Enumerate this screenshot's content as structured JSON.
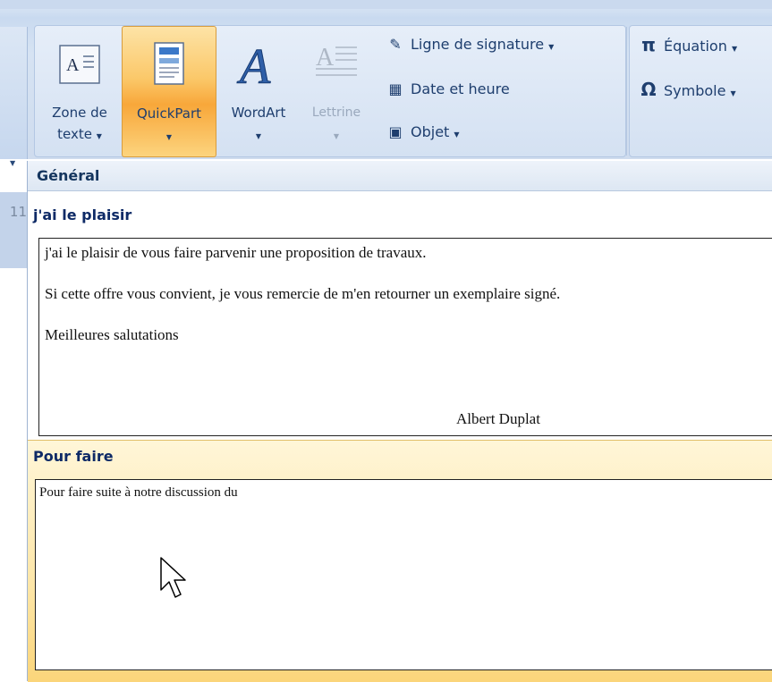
{
  "ribbon": {
    "text_box": {
      "line1": "Zone de",
      "line2": "texte",
      "icon_glyph": "A"
    },
    "quickpart": {
      "label": "QuickPart"
    },
    "wordart": {
      "label": "WordArt"
    },
    "dropcap": {
      "label": "Lettrine"
    },
    "signature_line": {
      "label": "Ligne de signature"
    },
    "date_time": {
      "label": "Date et heure"
    },
    "object": {
      "label": "Objet"
    },
    "equation": {
      "label": "Équation"
    },
    "symbol": {
      "label": "Symbole"
    },
    "caret": "▼"
  },
  "left_panel": {
    "number": "11"
  },
  "gallery": {
    "category": "Général",
    "entries": [
      {
        "title": "j'ai le plaisir",
        "lines": [
          "j'ai le plaisir de vous faire parvenir une proposition de travaux.",
          "Si cette offre vous convient, je vous remercie de m'en retourner un exemplaire signé.",
          "Meilleures salutations",
          "Albert Duplat"
        ]
      },
      {
        "title": "Pour faire",
        "lines": [
          "Pour faire suite à notre discussion du"
        ]
      }
    ]
  },
  "colors": {
    "ribbon_bg": "#d3e1f3",
    "active_button": "#f9b84a",
    "hover_highlight": "#fde6a8",
    "title_text": "#0e2a66"
  }
}
